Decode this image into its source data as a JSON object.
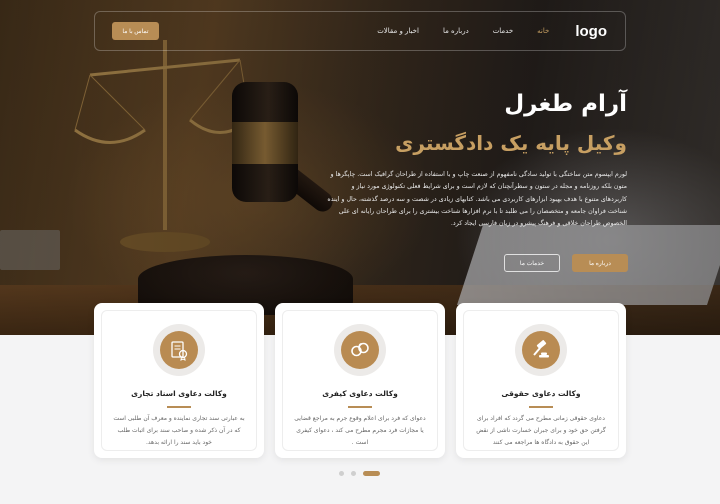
{
  "nav": {
    "logo": "logo",
    "contact_button": "تماس با ما",
    "items": [
      {
        "label": "خانه",
        "active": true
      },
      {
        "label": "خدمات",
        "active": false
      },
      {
        "label": "درباره ما",
        "active": false
      },
      {
        "label": "اخبار و مقالات",
        "active": false
      }
    ]
  },
  "hero": {
    "name": "آرام طغرل",
    "title": "وکیل پایه یک دادگستری",
    "description": "لورم ایپسوم متن ساختگی با تولید سادگی نامفهوم از صنعت چاپ و با استفاده از طراحان گرافیک است. چاپگرها و متون بلکه روزنامه و مجله در ستون و سطرآنچنان که لازم است و برای شرایط فعلی تکنولوژی مورد نیاز و کاربردهای متنوع با هدف بهبود ابزارهای کاربردی می باشد. کتابهای زیادی در شصت و سه درصد گذشته، حال و اینده شناخت فراوان جامعه و متخصصان را می طلبد تا با نرم افزارها شناخت بیشتری را برای طراحان رایانه ای علی الخصوص طراحان خلاقی و فرهنگ پیشرو در زبان فارسی ایجاد کرد.",
    "about_button": "درباره ما",
    "services_button": "خدمات ما"
  },
  "cards": [
    {
      "title": "وکالت دعاوی حقوقی",
      "text": "دعاوی حقوقی زمانی مطرح می گردد که افراد برای گرفتن حق خود و برای جبران خسارت ناشی از نقض این حقوق به دادگاه ها مراجعه می کنند",
      "icon": "gavel-icon"
    },
    {
      "title": "وکالت دعاوی کیفری",
      "text": "دعوای که فرد برای اعلام وقوع جرم به مراجع قضایی یا مجازات فرد مجرم مطرح می کند ، دعوای کیفری است .",
      "icon": "handcuffs-icon"
    },
    {
      "title": "وکالت دعاوی اسناد تجاری",
      "text": "به عبارتی سند تجاری نماینده و معرف آن طلبی است که در آن ذکر شده و صاحب سند برای اثبات طلب خود باید سند را ارائه بدهد.",
      "icon": "document-seal-icon"
    }
  ],
  "pagination": {
    "count": 3,
    "active_index": 2
  },
  "colors": {
    "accent": "#b88d55",
    "accent_text": "#c79f62"
  }
}
